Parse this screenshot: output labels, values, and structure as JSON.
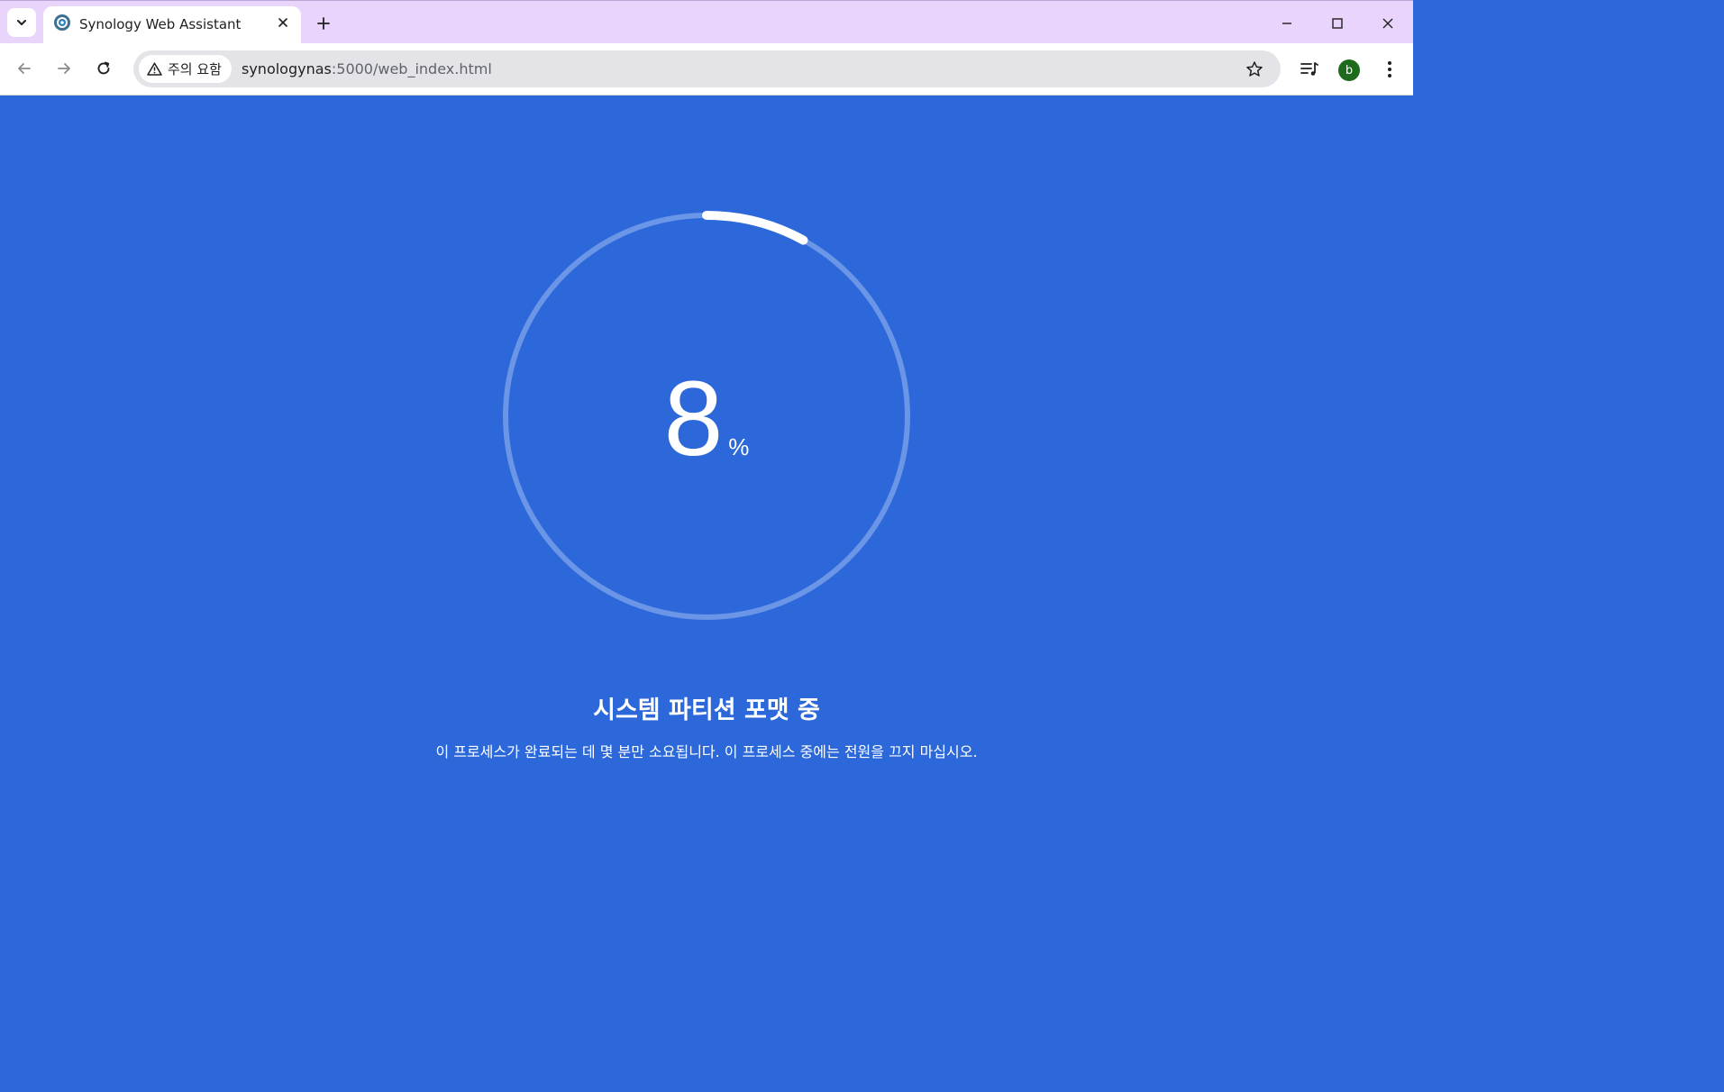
{
  "browser": {
    "tab": {
      "title": "Synology Web Assistant"
    },
    "address_bar": {
      "security_label": "주의 요함",
      "url_host": "synologynas",
      "url_path": ":5000/web_index.html"
    },
    "profile_initial": "b"
  },
  "page": {
    "progress": {
      "value": 8,
      "unit": "%"
    },
    "status_title": "시스템 파티션 포맷 중",
    "status_description": "이 프로세스가 완료되는 데 몇 분만 소요됩니다. 이 프로세스 중에는 전원을 끄지 마십시오."
  },
  "colors": {
    "page_background": "#2c68d9",
    "ring_track": "#6b95e6",
    "ring_progress": "#ffffff",
    "tabstrip": "#e9d4fc",
    "avatar": "#1e6b1e"
  },
  "icons": [
    "tab-search-icon",
    "synology-favicon",
    "close-icon",
    "plus-icon",
    "minimize-icon",
    "maximize-icon",
    "window-close-icon",
    "back-arrow-icon",
    "forward-arrow-icon",
    "reload-icon",
    "warning-icon",
    "star-icon",
    "media-control-icon",
    "kebab-menu-icon"
  ]
}
